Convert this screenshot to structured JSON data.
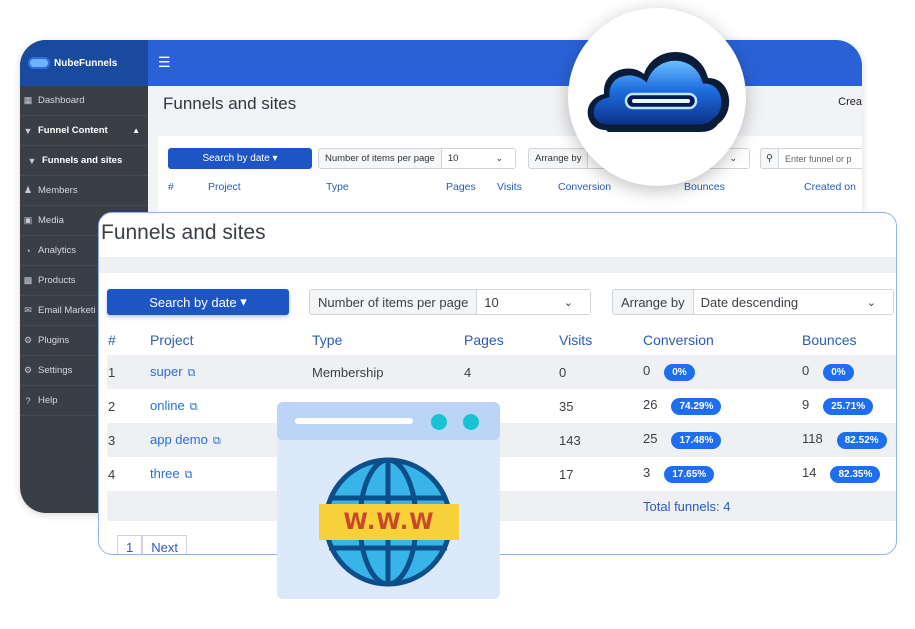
{
  "back_window": {
    "logo": "NubeFunnels",
    "sidebar": [
      {
        "label": "Dashboard",
        "icon": "dashboard-icon",
        "style": "normal"
      },
      {
        "label": "Funnel Content",
        "icon": "funnel-icon",
        "style": "bold"
      },
      {
        "label": "Funnels and sites",
        "icon": "funnel-icon",
        "style": "bold"
      },
      {
        "label": "Members",
        "icon": "members-icon",
        "style": "normal"
      },
      {
        "label": "Media",
        "icon": "media-icon",
        "style": "normal"
      },
      {
        "label": "Analytics",
        "icon": "pie-chart-icon",
        "style": "normal"
      },
      {
        "label": "Products",
        "icon": "products-icon",
        "style": "normal"
      },
      {
        "label": "Email Marketi",
        "icon": "email-icon",
        "style": "normal"
      },
      {
        "label": "Plugins",
        "icon": "plugins-icon",
        "style": "normal"
      },
      {
        "label": "Settings",
        "icon": "gear-icon",
        "style": "normal"
      },
      {
        "label": "Help",
        "icon": "help-icon",
        "style": "normal"
      }
    ],
    "page_title": "Funnels and sites",
    "create_text": "Crea",
    "search_by_date": "Search by date",
    "items_per_page_label": "Number of items per page",
    "items_per_page_value": "10",
    "arrange_label": "Arrange by",
    "search_placeholder": "Enter funnel or p",
    "headers": [
      "#",
      "Project",
      "Type",
      "Pages",
      "Visits",
      "Conversion",
      "Bounces",
      "Created on"
    ]
  },
  "front_window": {
    "page_title": "Funnels and sites",
    "search_by_date": "Search by date",
    "items_per_page_label": "Number of items per page",
    "items_per_page_value": "10",
    "arrange_label": "Arrange by",
    "arrange_value": "Date descending",
    "headers": [
      "#",
      "Project",
      "Type",
      "Pages",
      "Visits",
      "Conversion",
      "Bounces"
    ],
    "rows": [
      {
        "n": "1",
        "project": "super",
        "type": "Membership",
        "pages": "4",
        "visits": "0",
        "conversion": "0",
        "conversion_pct": "0%",
        "bounces": "0",
        "bounces_pct": "0%"
      },
      {
        "n": "2",
        "project": "online",
        "type": "",
        "pages": "",
        "visits": "35",
        "conversion": "26",
        "conversion_pct": "74.29%",
        "bounces": "9",
        "bounces_pct": "25.71%"
      },
      {
        "n": "3",
        "project": "app demo",
        "type": "",
        "pages": "",
        "visits": "143",
        "conversion": "25",
        "conversion_pct": "17.48%",
        "bounces": "118",
        "bounces_pct": "82.52%"
      },
      {
        "n": "4",
        "project": "three",
        "type": "",
        "pages": "",
        "visits": "17",
        "conversion": "3",
        "conversion_pct": "17.65%",
        "bounces": "14",
        "bounces_pct": "82.35%"
      }
    ],
    "total": "Total funnels: 4",
    "pagination": [
      "1",
      "Next"
    ]
  },
  "www_text": "W.W.W",
  "colors": {
    "primary": "#1d56c4",
    "topbar": "#2a62d6",
    "sidebar": "#3a3f46",
    "pill": "#1d6ef0",
    "link": "#2a6fd6"
  }
}
